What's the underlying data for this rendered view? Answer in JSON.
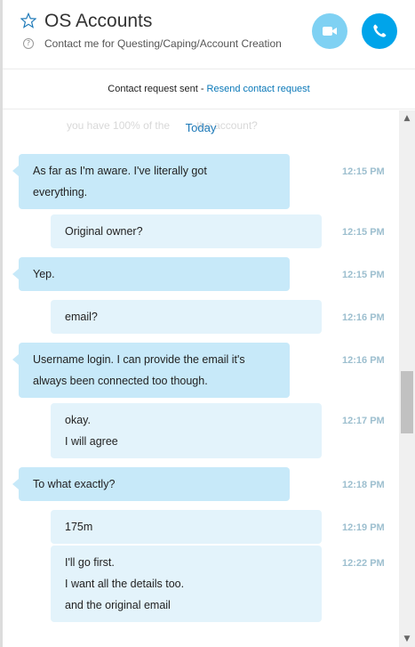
{
  "header": {
    "title": "OS Accounts",
    "subtitle": "Contact me for Questing/Caping/Account Creation",
    "help_glyph": "?",
    "video_icon": "video-camera-icon",
    "call_icon": "phone-icon",
    "accent_color": "#00a4ea"
  },
  "status": {
    "text": "Contact request sent - ",
    "link": "Resend contact request"
  },
  "chat": {
    "faded_preview": "you have 100% of the",
    "faded_preview_end": "the account?",
    "date_separator": "Today",
    "messages": [
      {
        "dir": "in",
        "lines": [
          "As far as I'm aware. I've literally got",
          "everything."
        ],
        "time": "12:15 PM"
      },
      {
        "dir": "out",
        "lines": [
          "Original owner?"
        ],
        "time": "12:15 PM"
      },
      {
        "dir": "in",
        "lines": [
          "Yep."
        ],
        "time": "12:15 PM"
      },
      {
        "dir": "out",
        "lines": [
          "email?"
        ],
        "time": "12:16 PM"
      },
      {
        "dir": "in",
        "lines": [
          "Username login. I can provide the email it's",
          "always been connected too though."
        ],
        "time": "12:16 PM"
      },
      {
        "dir": "out",
        "lines": [
          "okay.",
          "I will agree"
        ],
        "time": "12:17 PM"
      },
      {
        "dir": "in",
        "lines": [
          "To what exactly?"
        ],
        "time": "12:18 PM"
      },
      {
        "dir": "out",
        "lines": [
          "175m"
        ],
        "time": "12:19 PM"
      },
      {
        "dir": "out",
        "lines": [
          "I'll go first.",
          "I want all the details too.",
          "and the original email"
        ],
        "time": "12:22 PM"
      }
    ]
  },
  "scrollbar": {
    "up_glyph": "▲",
    "down_glyph": "▼"
  }
}
